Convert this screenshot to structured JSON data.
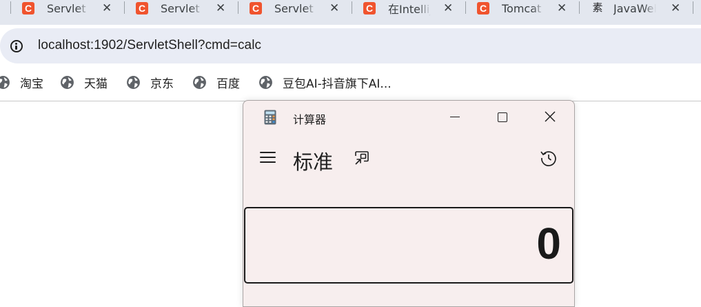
{
  "browser": {
    "tabs": [
      {
        "title": "Servlet",
        "favicon": "C"
      },
      {
        "title": "Servlet",
        "favicon": "C"
      },
      {
        "title": "Servlet",
        "favicon": "C"
      },
      {
        "title": "在IntelliJ",
        "favicon": "C"
      },
      {
        "title": "Tomcat",
        "favicon": "C"
      },
      {
        "title": "JavaWeb",
        "favicon": "素"
      }
    ],
    "close_glyph": "✕",
    "url": "localhost:1902/ServletShell?cmd=calc",
    "bookmarks": [
      {
        "label": "淘宝",
        "icon": "globe-icon"
      },
      {
        "label": "天猫",
        "icon": "globe-icon"
      },
      {
        "label": "京东",
        "icon": "globe-icon"
      },
      {
        "label": "百度",
        "icon": "globe-icon"
      },
      {
        "label": "豆包AI-抖音旗下AI...",
        "icon": "globe-icon"
      }
    ]
  },
  "calculator": {
    "window_title": "计算器",
    "mode": "标准",
    "display_value": "0"
  }
}
